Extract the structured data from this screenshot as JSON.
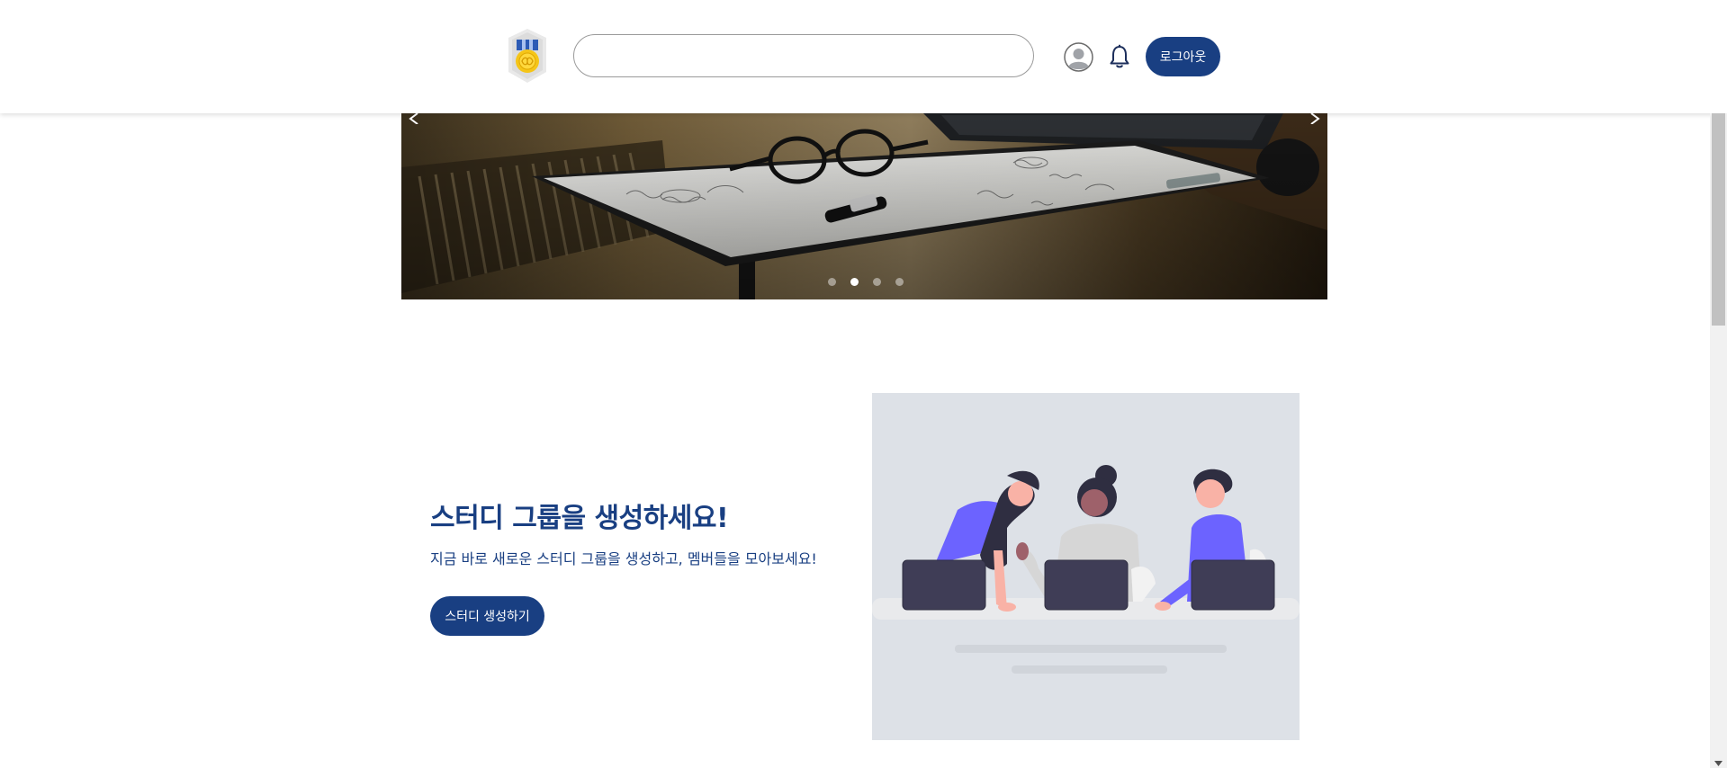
{
  "header": {
    "logo_icon": "medal-logo-icon",
    "search": {
      "value": "",
      "placeholder": ""
    },
    "profile_icon": "user-circle-icon",
    "bell_icon": "bell-icon",
    "logout_label": "로그아웃"
  },
  "carousel": {
    "slide_count": 4,
    "active_index": 1,
    "image": "desk-with-glasses-and-whiteboard-photo"
  },
  "hero": {
    "title": "스터디 그룹을 생성하세요!",
    "subtitle": "지금 바로 새로운 스터디 그룹을 생성하고, 멤버들을 모아보세요!",
    "button_label": "스터디 생성하기",
    "illustration": "team-meeting-illustration"
  },
  "colors": {
    "brand": "#193f82",
    "accent_purple": "#6c63ff",
    "illustration_bg": "#dde1e7"
  }
}
